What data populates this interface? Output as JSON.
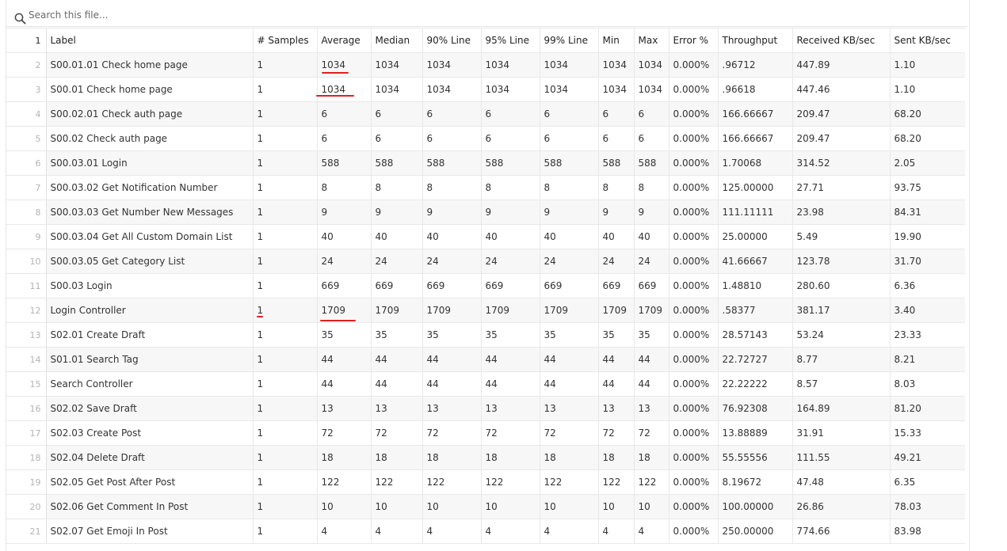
{
  "search": {
    "placeholder": "Search this file..."
  },
  "table": {
    "line_numbers": [
      "1",
      "2",
      "3",
      "4",
      "5",
      "6",
      "7",
      "8",
      "9",
      "10",
      "11",
      "12",
      "13",
      "14",
      "15",
      "16",
      "17",
      "18",
      "19",
      "20",
      "21"
    ],
    "header": [
      "Label",
      "# Samples",
      "Average",
      "Median",
      "90% Line",
      "95% Line",
      "99% Line",
      "Min",
      "Max",
      "Error %",
      "Throughput",
      "Received KB/sec",
      "Sent KB/sec"
    ],
    "rows": [
      [
        "S00.01.01 Check home page",
        "1",
        "1034",
        "1034",
        "1034",
        "1034",
        "1034",
        "1034",
        "1034",
        "0.000%",
        ".96712",
        "447.89",
        "1.10"
      ],
      [
        "S00.01 Check home page",
        "1",
        "1034",
        "1034",
        "1034",
        "1034",
        "1034",
        "1034",
        "1034",
        "0.000%",
        ".96618",
        "447.46",
        "1.10"
      ],
      [
        "S00.02.01 Check auth page",
        "1",
        "6",
        "6",
        "6",
        "6",
        "6",
        "6",
        "6",
        "0.000%",
        "166.66667",
        "209.47",
        "68.20"
      ],
      [
        "S00.02 Check auth page",
        "1",
        "6",
        "6",
        "6",
        "6",
        "6",
        "6",
        "6",
        "0.000%",
        "166.66667",
        "209.47",
        "68.20"
      ],
      [
        "S00.03.01 Login",
        "1",
        "588",
        "588",
        "588",
        "588",
        "588",
        "588",
        "588",
        "0.000%",
        "1.70068",
        "314.52",
        "2.05"
      ],
      [
        "S00.03.02 Get Notification Number",
        "1",
        "8",
        "8",
        "8",
        "8",
        "8",
        "8",
        "8",
        "0.000%",
        "125.00000",
        "27.71",
        "93.75"
      ],
      [
        "S00.03.03 Get Number New Messages",
        "1",
        "9",
        "9",
        "9",
        "9",
        "9",
        "9",
        "9",
        "0.000%",
        "111.11111",
        "23.98",
        "84.31"
      ],
      [
        "S00.03.04 Get All Custom Domain List",
        "1",
        "40",
        "40",
        "40",
        "40",
        "40",
        "40",
        "40",
        "0.000%",
        "25.00000",
        "5.49",
        "19.90"
      ],
      [
        "S00.03.05 Get Category List",
        "1",
        "24",
        "24",
        "24",
        "24",
        "24",
        "24",
        "24",
        "0.000%",
        "41.66667",
        "123.78",
        "31.70"
      ],
      [
        "S00.03 Login",
        "1",
        "669",
        "669",
        "669",
        "669",
        "669",
        "669",
        "669",
        "0.000%",
        "1.48810",
        "280.60",
        "6.36"
      ],
      [
        "Login Controller",
        "1",
        "1709",
        "1709",
        "1709",
        "1709",
        "1709",
        "1709",
        "1709",
        "0.000%",
        ".58377",
        "381.17",
        "3.40"
      ],
      [
        "S02.01 Create Draft",
        "1",
        "35",
        "35",
        "35",
        "35",
        "35",
        "35",
        "35",
        "0.000%",
        "28.57143",
        "53.24",
        "23.33"
      ],
      [
        "S01.01 Search Tag",
        "1",
        "44",
        "44",
        "44",
        "44",
        "44",
        "44",
        "44",
        "0.000%",
        "22.72727",
        "8.77",
        "8.21"
      ],
      [
        "Search Controller",
        "1",
        "44",
        "44",
        "44",
        "44",
        "44",
        "44",
        "44",
        "0.000%",
        "22.22222",
        "8.57",
        "8.03"
      ],
      [
        "S02.02 Save Draft",
        "1",
        "13",
        "13",
        "13",
        "13",
        "13",
        "13",
        "13",
        "0.000%",
        "76.92308",
        "164.89",
        "81.20"
      ],
      [
        "S02.03 Create Post",
        "1",
        "72",
        "72",
        "72",
        "72",
        "72",
        "72",
        "72",
        "0.000%",
        "13.88889",
        "31.91",
        "15.33"
      ],
      [
        "S02.04 Delete Draft",
        "1",
        "18",
        "18",
        "18",
        "18",
        "18",
        "18",
        "18",
        "0.000%",
        "55.55556",
        "111.55",
        "49.21"
      ],
      [
        "S02.05 Get Post After Post",
        "1",
        "122",
        "122",
        "122",
        "122",
        "122",
        "122",
        "122",
        "0.000%",
        "8.19672",
        "47.48",
        "6.35"
      ],
      [
        "S02.06 Get Comment In Post",
        "1",
        "10",
        "10",
        "10",
        "10",
        "10",
        "10",
        "10",
        "0.000%",
        "100.00000",
        "26.86",
        "78.03"
      ],
      [
        "S02.07 Get Emoji In Post",
        "1",
        "4",
        "4",
        "4",
        "4",
        "4",
        "4",
        "4",
        "0.000%",
        "250.00000",
        "774.66",
        "83.98"
      ]
    ]
  },
  "annotations": {
    "underline_color": "#e02020"
  },
  "colors": {
    "border": "#e8e8e8",
    "stripe": "#f7f7f7",
    "line_number": "#b3b3b3"
  }
}
